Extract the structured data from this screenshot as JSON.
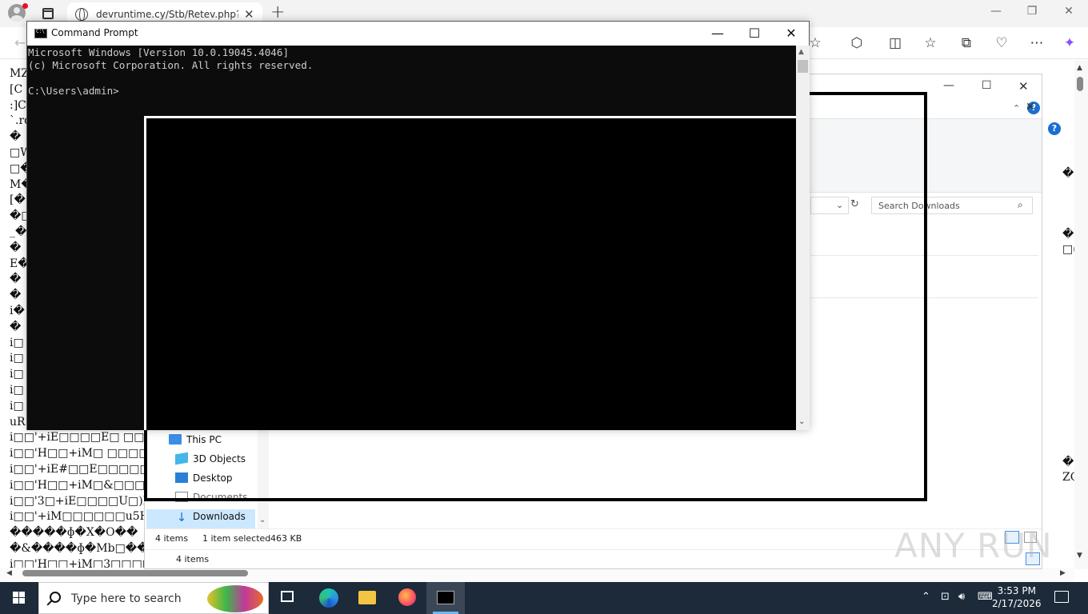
{
  "browser": {
    "tab_title": "devruntime.cy/Stb/Retev.php?bl=",
    "tab_close": "✕",
    "new_tab": "+",
    "minimize": "—",
    "restore": "❐",
    "close": "✕"
  },
  "page": {
    "lines": "MZ\n[C\n:]C\n`.rd\n�\n□W\n□�\nM�\n[�\n�□\n_�\n�\nE�\n�\n�\ni�\n�\ni□\ni□\ni□\ni□\ni□\nuR\ni□□'+iE□□□□E□ □□□\ni□□'H□□+iM□ □□□□\ni□□'+iE#□□E□□□□□□\ni□□'H□□+iM□&□□□□\ni□□'3□+iE□□□□U□)H\ni□□'+iM□□□□□□u5H\n�����ɸ�X�O��\n�&����ɸ�Mb□��\ni□□'H□□+iM□3□□□□□ɸ",
    "right_glyphs": "�I\n\n\n\n�\n□(\n\n\n\n\n\n\n\n\n\n\n\n\n\n�\nZC"
  },
  "explorer": {
    "search_placeholder": "Search Downloads",
    "nav": {
      "this_pc": "This PC",
      "objects3d": "3D Objects",
      "desktop": "Desktop",
      "documents": "Documents",
      "downloads": "Downloads"
    },
    "status_items": "4 items",
    "status_selected": "1 item selected",
    "status_size": "463 KB",
    "status_items_2": "4 items"
  },
  "cmd": {
    "title": "Command Prompt",
    "minimize": "—",
    "maximize": "☐",
    "close": "✕",
    "console_text": "Microsoft Windows [Version 10.0.19045.4046]\n(c) Microsoft Corporation. All rights reserved.\n\nC:\\Users\\admin>"
  },
  "taskbar": {
    "search_placeholder": "Type here to search",
    "time": "3:53 PM",
    "date": "2/17/2026"
  },
  "watermark": "ANY RUN",
  "colors": {
    "console_bg": "#0c0c0c",
    "console_fg": "#cccccc",
    "taskbar_bg": "#1c2a3a",
    "selection": "#cce8ff"
  }
}
